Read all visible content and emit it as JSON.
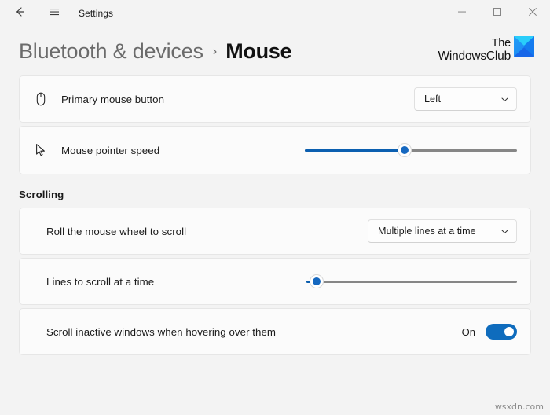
{
  "window": {
    "app_title": "Settings",
    "back_icon": "back-arrow-icon",
    "menu_icon": "hamburger-menu-icon",
    "minimize_label": "—",
    "maximize_label": "□",
    "close_label": "✕"
  },
  "header": {
    "breadcrumb_parent": "Bluetooth & devices",
    "breadcrumb_separator": "›",
    "breadcrumb_current": "Mouse"
  },
  "brand": {
    "line1": "The",
    "line2": "WindowsClub",
    "mark_color_light": "#25c9f5",
    "mark_color_dark": "#1560e8"
  },
  "settings": [
    {
      "id": "primary-mouse-button",
      "icon": "mouse-icon",
      "label": "Primary mouse button",
      "control": "dropdown",
      "value": "Left"
    },
    {
      "id": "mouse-pointer-speed",
      "icon": "cursor-pointer-icon",
      "label": "Mouse pointer speed",
      "control": "slider",
      "percent": 47
    }
  ],
  "scrolling": {
    "section_title": "Scrolling",
    "items": [
      {
        "id": "roll-mouse-wheel-to-scroll",
        "label": "Roll the mouse wheel to scroll",
        "control": "dropdown",
        "value": "Multiple lines at a time"
      },
      {
        "id": "lines-to-scroll-at-a-time",
        "label": "Lines to scroll at a time",
        "control": "slider",
        "percent": 5
      },
      {
        "id": "scroll-inactive-windows",
        "label": "Scroll inactive windows when hovering over them",
        "control": "toggle",
        "state_label": "On",
        "state_on": true
      }
    ]
  },
  "colors": {
    "page_background": "#f3f3f3",
    "card_background": "#fbfbfb",
    "accent": "#0f6cbd",
    "slider_fill": "#0b5fb0",
    "slider_track": "#868686"
  },
  "watermark": "wsxdn.com"
}
